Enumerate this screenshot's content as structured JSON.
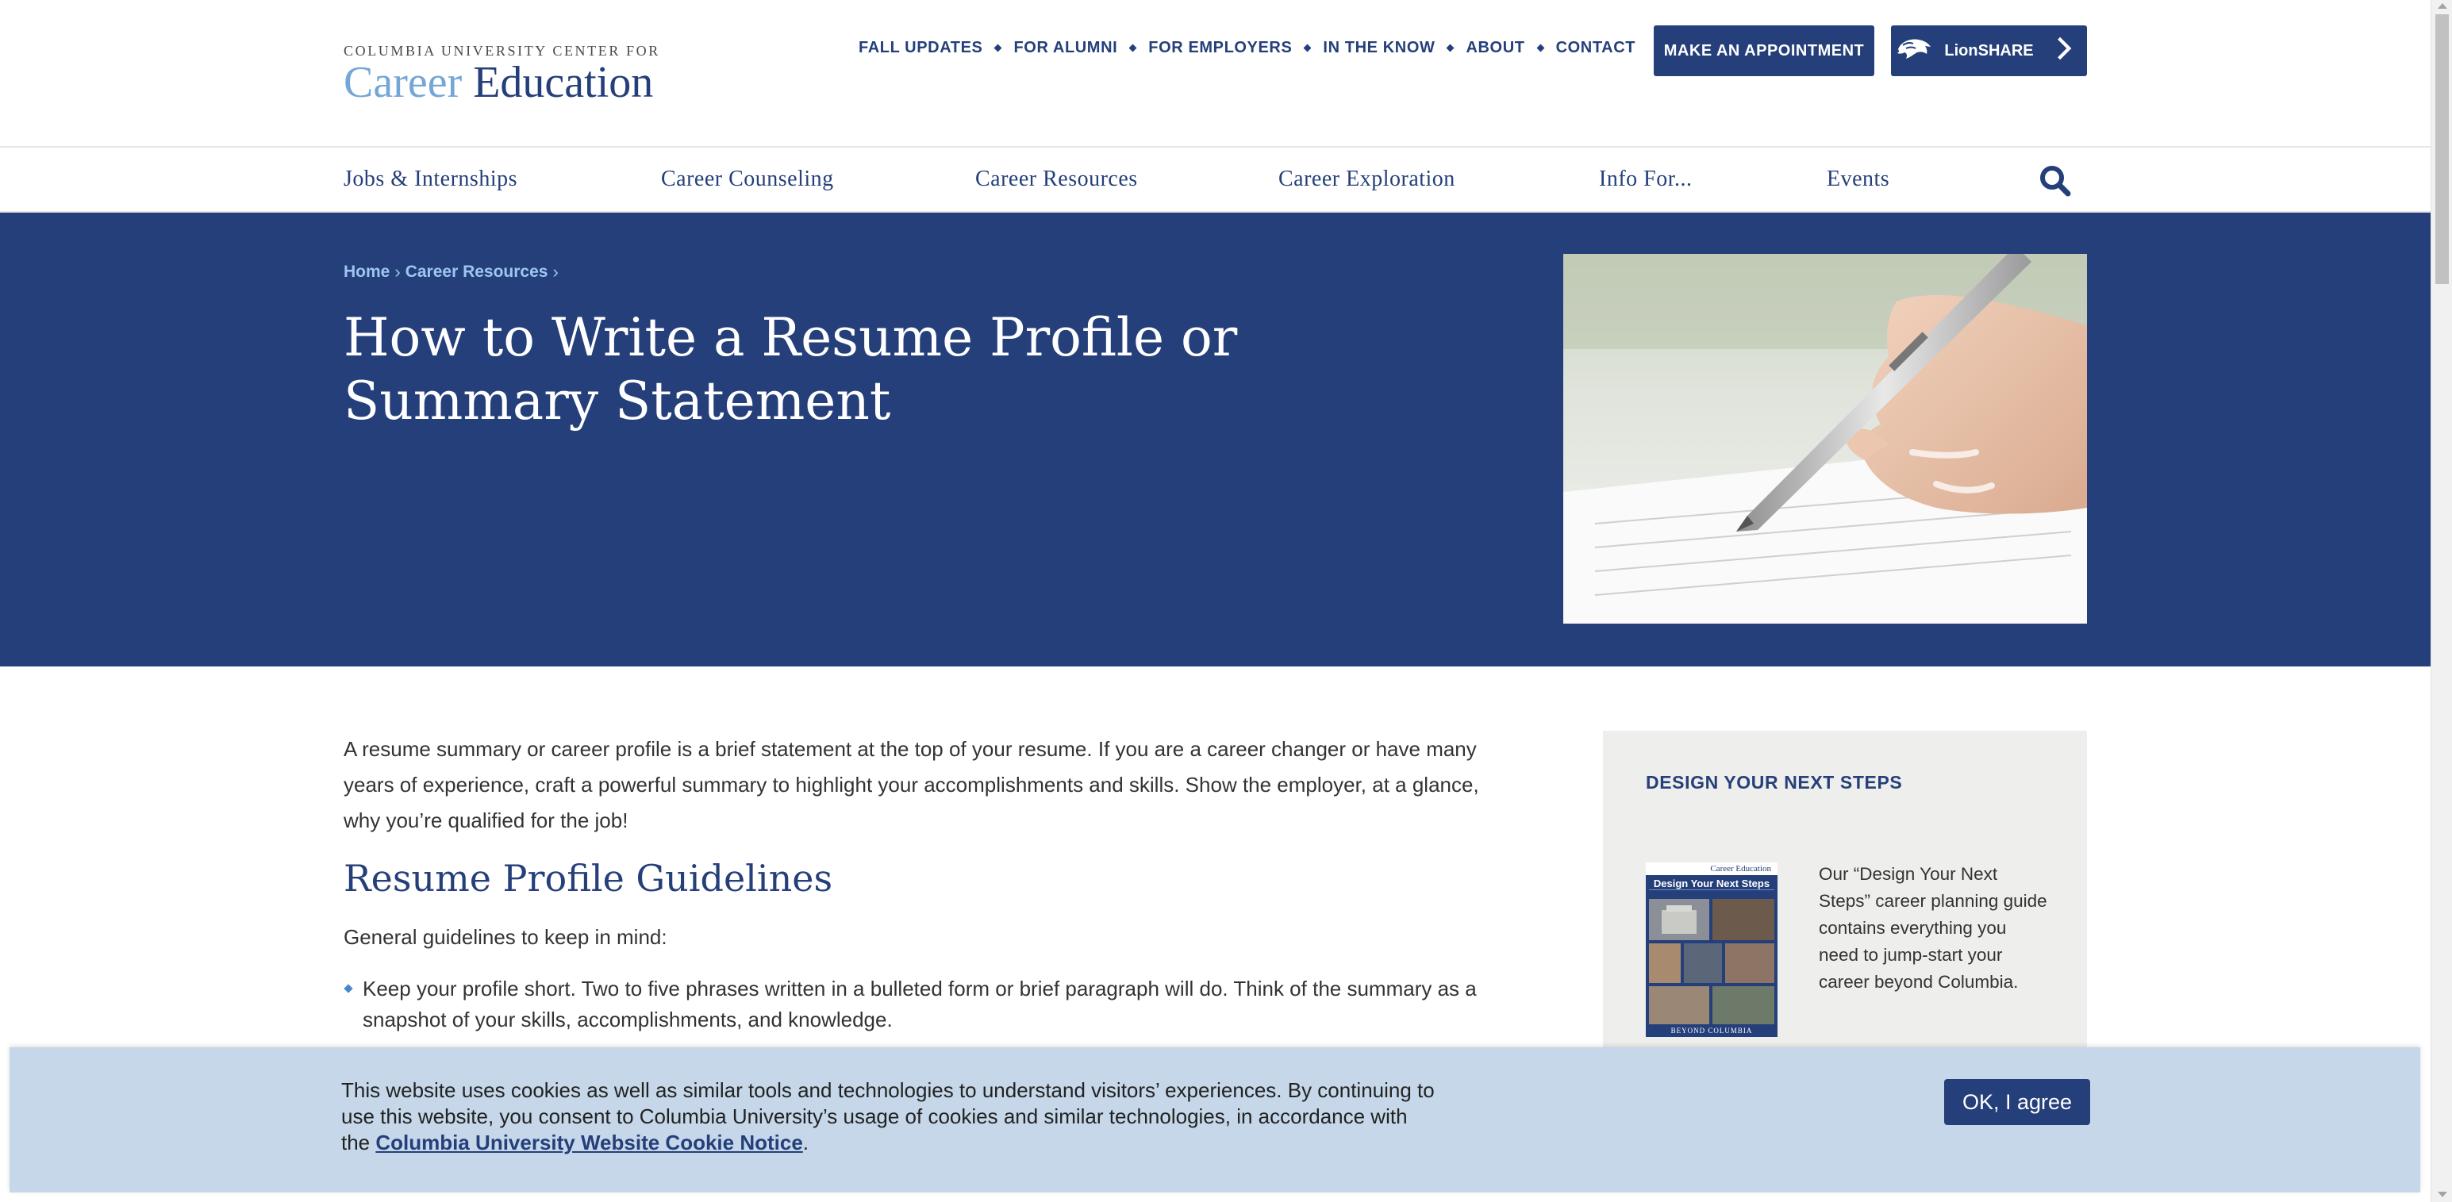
{
  "logo": {
    "small_line": "COLUMBIA UNIVERSITY CENTER FOR",
    "word_career": "Career",
    "word_education": "Education"
  },
  "utility_nav": [
    "FALL UPDATES",
    "FOR ALUMNI",
    "FOR EMPLOYERS",
    "IN THE KNOW",
    "ABOUT",
    "CONTACT"
  ],
  "header_buttons": {
    "appointment": "MAKE AN APPOINTMENT",
    "lionshare": "LionSHARE"
  },
  "main_nav": [
    "Jobs & Internships",
    "Career Counseling",
    "Career Resources",
    "Career Exploration",
    "Info For...",
    "Events"
  ],
  "hero": {
    "breadcrumb": [
      "Home",
      "Career Resources"
    ],
    "title": "How to Write a Resume Profile or Summary Statement"
  },
  "content": {
    "intro": "A resume summary or career profile is a brief statement at the top of your resume. If you are a career changer or have many years of experience, craft a powerful summary to highlight your accomplishments and skills.  Show the employer, at a glance, why you’re qualified for the job!",
    "guidelines_heading": "Resume Profile Guidelines",
    "general": "General guidelines to keep in mind:",
    "bullets": [
      "Keep your profile short. Two to five phrases written in a bulleted form or brief paragraph will do. Think of the summary as a snapshot of your skills,  accomplishments, and knowledge."
    ]
  },
  "sidebar": {
    "heading": "DESIGN YOUR NEXT STEPS",
    "text": "Our “Design Your Next Steps” career planning guide contains everything you need to jump-start your career beyond Columbia.",
    "thumb": {
      "brand": "Career Education",
      "title": "Design Your Next Steps",
      "footer": "BEYOND COLUMBIA"
    }
  },
  "cookie": {
    "text_before": "This website uses cookies as well as similar tools and technologies to understand visitors’ experiences. By continuing to use this website, you consent to Columbia University’s usage of cookies and similar technologies, in accordance with the ",
    "link": "Columbia University Website Cookie Notice",
    "text_after": ".",
    "button": "OK, I agree"
  },
  "colors": {
    "brand_navy": "#253f7a",
    "brand_light_blue": "#74a7d6",
    "breadcrumb_blue": "#9cc7f0",
    "cookie_bg": "#c5d7e9",
    "sidebar_bg": "#eeeeec"
  },
  "icons": {
    "search": "search-icon",
    "lion": "lion-icon",
    "chevron": "chevron-right-icon",
    "bullet": "diamond-bullet-icon"
  }
}
